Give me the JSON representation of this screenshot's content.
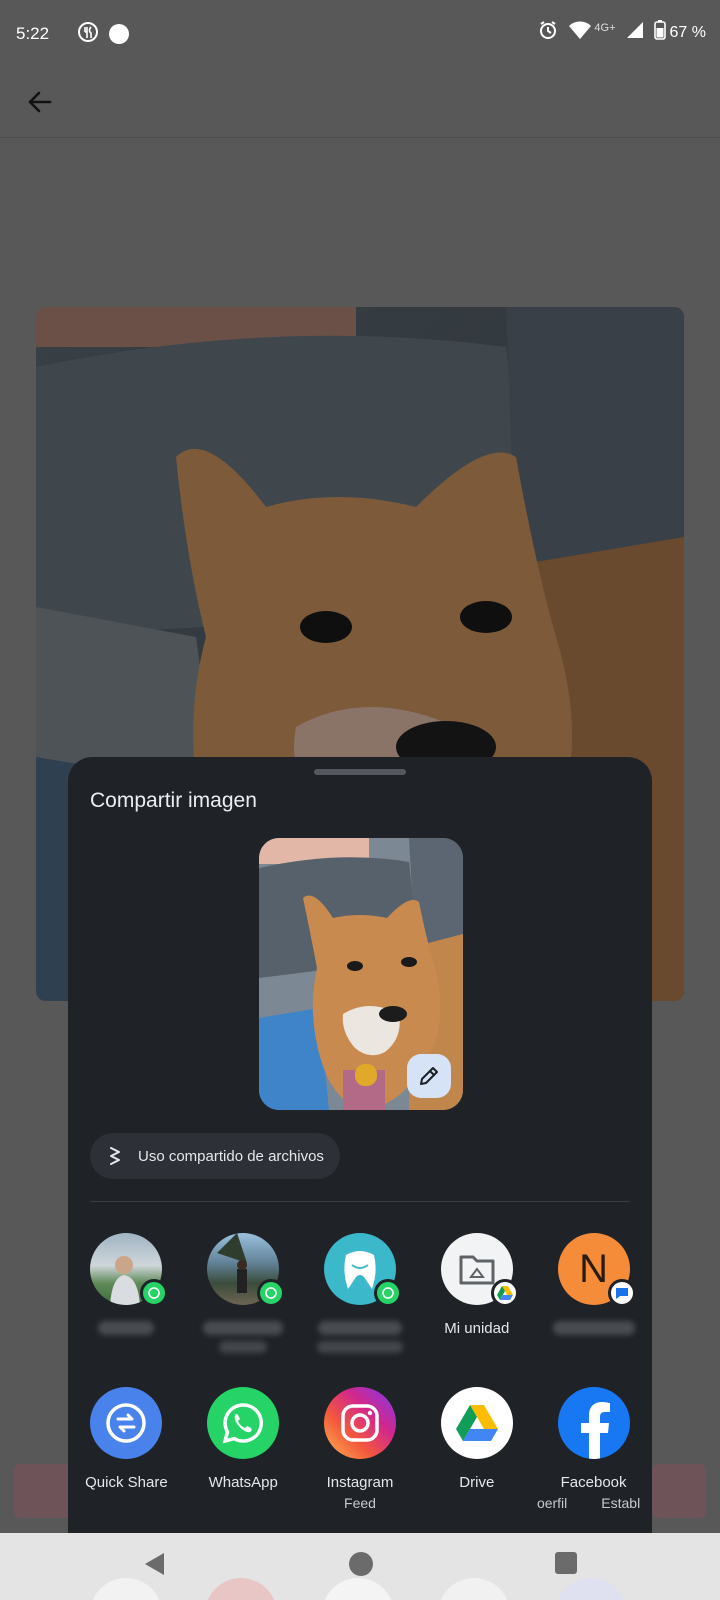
{
  "status_bar": {
    "time": "5:22",
    "network": "4G+",
    "battery": "67 %"
  },
  "sheet": {
    "title": "Compartir imagen",
    "file_sharing_chip": "Uso compartido de archivos",
    "contacts": [
      {
        "label": "",
        "badge_icon": "whatsapp-badge-icon"
      },
      {
        "label": "",
        "badge_icon": "whatsapp-badge-icon"
      },
      {
        "label": "",
        "badge_icon": "whatsapp-badge-icon"
      },
      {
        "label": "Mi unidad",
        "badge_icon": "drive-badge-icon"
      },
      {
        "label": "",
        "avatar_letter": "N",
        "badge_icon": "messages-badge-icon"
      }
    ],
    "apps": [
      {
        "label": "Quick Share",
        "sub": "",
        "icon": "quick-share-icon",
        "color": "#4a82ec"
      },
      {
        "label": "WhatsApp",
        "sub": "",
        "icon": "whatsapp-icon",
        "color": "#25d366"
      },
      {
        "label": "Instagram",
        "sub": "Feed",
        "icon": "instagram-icon",
        "color": "#e1306c"
      },
      {
        "label": "Drive",
        "sub": "",
        "icon": "drive-icon",
        "color": "#ffffff"
      },
      {
        "label": "Facebook",
        "sub": "Establ",
        "sub_left": "oerfil",
        "icon": "facebook-icon",
        "color": "#1877f2"
      }
    ]
  },
  "colors": {
    "sheet_bg": "#1f2227",
    "scrim": "#585858",
    "accent_whatsapp": "#25d366",
    "accent_avatar_orange": "#f48c3a"
  }
}
